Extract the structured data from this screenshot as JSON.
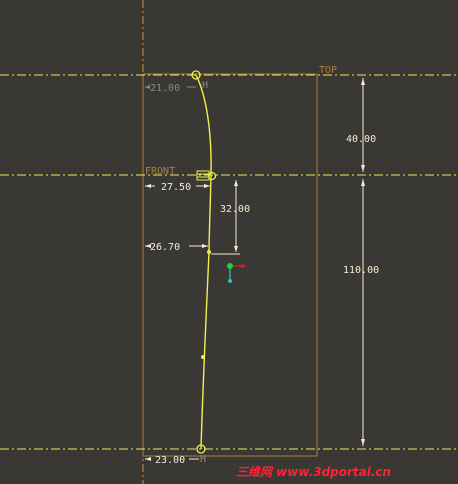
{
  "datums": {
    "top_label": "TOP",
    "front_label": "FRONT"
  },
  "dimensions": {
    "top_radius": "21.00",
    "front_radius": "27.50",
    "mid_radius": "26.70",
    "bottom_radius": "23.00",
    "top_to_front": "40.00",
    "front_to_bottom": "110.00",
    "front_to_mid": "32.00"
  },
  "constraints": {
    "horizontal_symbol": "H"
  },
  "watermark": {
    "text": "三维网 www.3dportal.cn"
  },
  "colors": {
    "background": "#3a3835",
    "datum": "#eaea5a",
    "sketch": "#f0f04a",
    "reference": "#b07c3d",
    "dimension": "#f2eecb",
    "watermark": "#ff2233"
  }
}
